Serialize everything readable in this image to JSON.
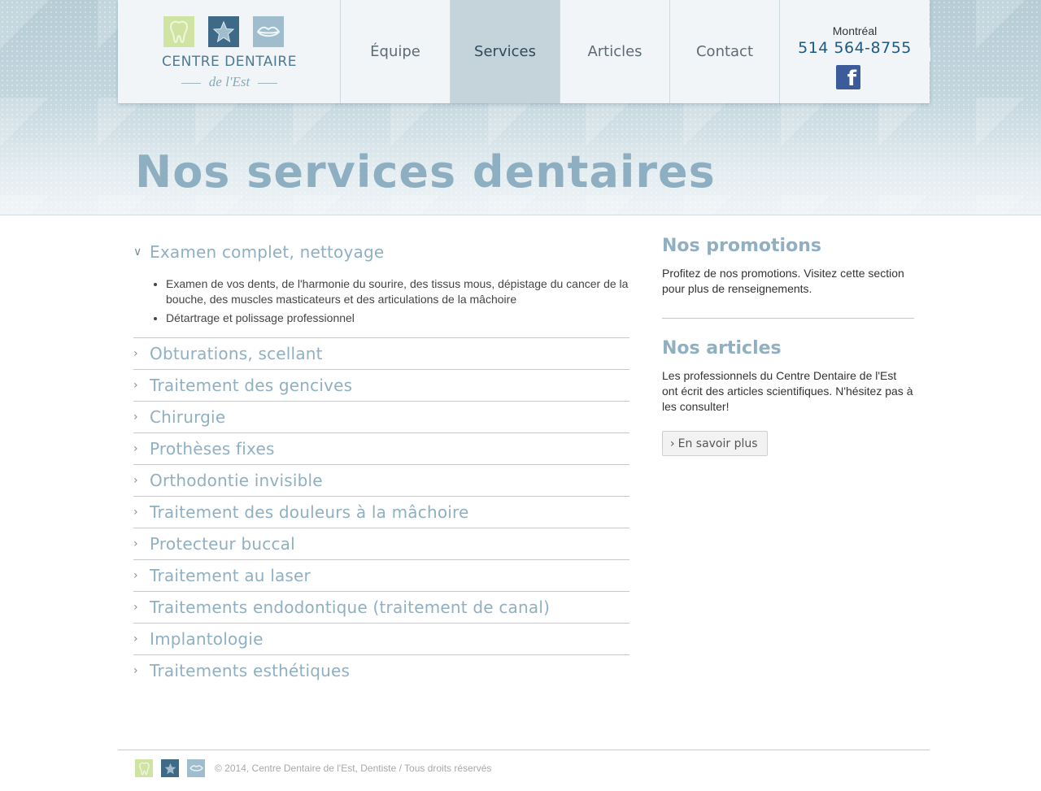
{
  "logo": {
    "title": "CENTRE DENTAIRE",
    "subtitle": "de l'Est",
    "icons": [
      "tooth-icon",
      "star-icon",
      "lips-icon"
    ]
  },
  "nav": {
    "items": [
      {
        "label": "Équipe",
        "active": false
      },
      {
        "label": "Services",
        "active": true
      },
      {
        "label": "Articles",
        "active": false
      },
      {
        "label": "Contact",
        "active": false
      }
    ]
  },
  "contact": {
    "city": "Montréal",
    "phone": "514 564-8755",
    "social_icon": "facebook-icon"
  },
  "page": {
    "title": "Nos services dentaires"
  },
  "services": [
    {
      "title": "Examen complet, nettoyage",
      "open": true,
      "bullets": [
        "Examen de vos dents, de l'harmonie du sourire, des tissus mous, dépistage du cancer de la bouche, des muscles masticateurs et des articulations de la mâchoire",
        "Détartrage et polissage professionnel"
      ]
    },
    {
      "title": "Obturations, scellant",
      "open": false
    },
    {
      "title": "Traitement des gencives",
      "open": false
    },
    {
      "title": "Chirurgie",
      "open": false
    },
    {
      "title": "Prothèses fixes",
      "open": false
    },
    {
      "title": "Orthodontie invisible",
      "open": false
    },
    {
      "title": "Traitement des douleurs à la mâchoire",
      "open": false
    },
    {
      "title": "Protecteur buccal",
      "open": false
    },
    {
      "title": "Traitement au laser",
      "open": false
    },
    {
      "title": "Traitements endodontique (traitement de canal)",
      "open": false
    },
    {
      "title": "Implantologie",
      "open": false
    },
    {
      "title": "Traitements esthétiques",
      "open": false
    }
  ],
  "sidebar": {
    "promotions": {
      "title": "Nos promotions",
      "text": "Profitez de nos promotions. Visitez cette section pour plus de renseignements."
    },
    "articles": {
      "title": "Nos articles",
      "text": "Les professionnels du Centre Dentaire de l'Est ont écrit des articles scientifiques. N'hésitez pas à les consulter!",
      "button_label": "En savoir plus"
    }
  },
  "footer": {
    "copyright": "© 2014, Centre Dentaire de l'Est, Dentiste / Tous droits réservés"
  },
  "colors": {
    "accent": "#8fb0c2",
    "phone": "#1f5a82",
    "nav_active_bg": "#c5d3da"
  }
}
